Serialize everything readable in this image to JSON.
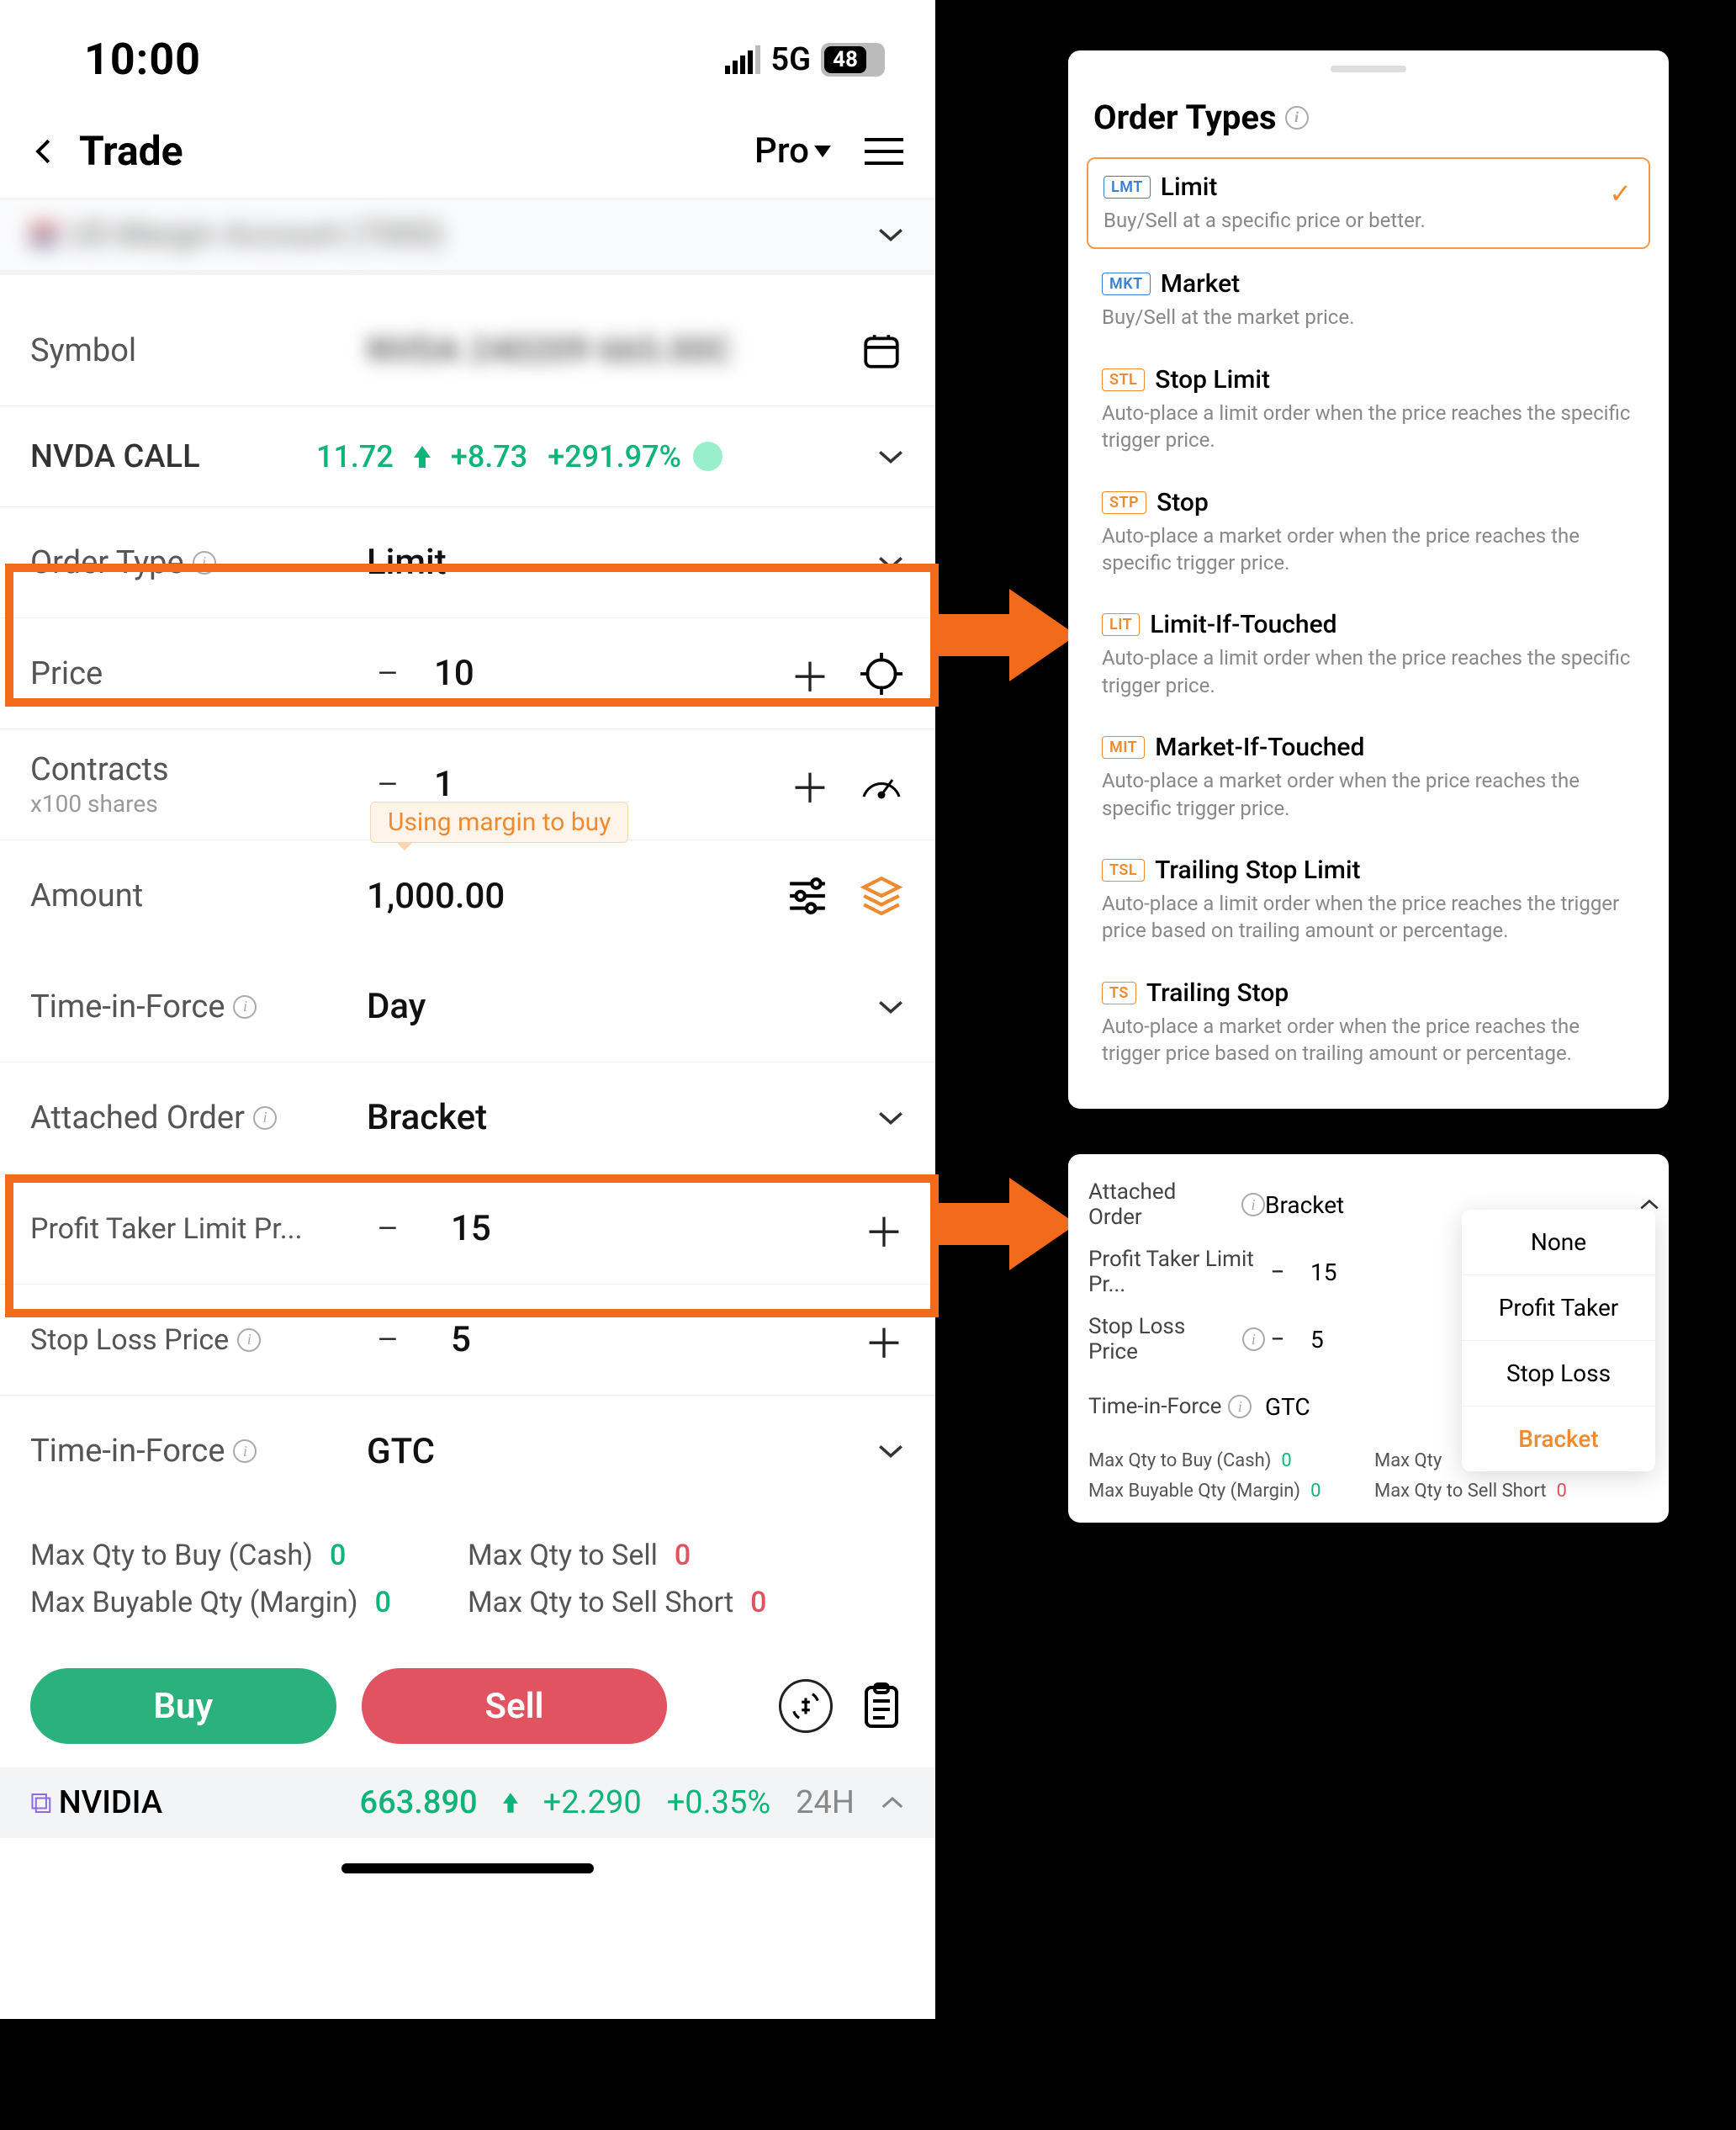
{
  "statusbar": {
    "time": "10:00",
    "signal": "5G",
    "battery": "48"
  },
  "nav": {
    "title": "Trade",
    "mode": "Pro"
  },
  "account_blur": "US Margin Account (7000)   ",
  "symbol": {
    "label": "Symbol",
    "value": "NVDA 240209 665.00C"
  },
  "quote": {
    "name": "NVDA CALL",
    "price": "11.72",
    "change": "+8.73",
    "pct": "+291.97%"
  },
  "order_type": {
    "label": "Order Type",
    "value": "Limit"
  },
  "price": {
    "label": "Price",
    "value": "10"
  },
  "contracts": {
    "label": "Contracts",
    "sub": "x100 shares",
    "value": "1"
  },
  "margin_badge": "Using margin to buy",
  "amount": {
    "label": "Amount",
    "value": "1,000.00"
  },
  "tif": {
    "label": "Time-in-Force",
    "value": "Day"
  },
  "attached": {
    "label": "Attached Order",
    "value": "Bracket"
  },
  "profit_taker": {
    "label": "Profit Taker Limit Pr...",
    "value": "15"
  },
  "stop_loss": {
    "label": "Stop Loss Price",
    "value": "5"
  },
  "tif2": {
    "label": "Time-in-Force",
    "value": "GTC"
  },
  "summary": {
    "buy_cash": {
      "label": "Max Qty to Buy (Cash)",
      "value": "0"
    },
    "buy_margin": {
      "label": "Max Buyable Qty (Margin)",
      "value": "0"
    },
    "sell": {
      "label": "Max Qty to Sell",
      "value": "0"
    },
    "sell_short": {
      "label": "Max Qty to Sell Short",
      "value": "0"
    }
  },
  "actions": {
    "buy": "Buy",
    "sell": "Sell"
  },
  "ticker": {
    "name": "NVIDIA",
    "price": "663.890",
    "change": "+2.290",
    "pct": "+0.35%",
    "tf": "24H"
  },
  "order_types_panel": {
    "title": "Order Types",
    "items": [
      {
        "tag": "LMT",
        "tagcolor": "blue",
        "name": "Limit",
        "desc": "Buy/Sell at a specific price or better.",
        "selected": true
      },
      {
        "tag": "MKT",
        "tagcolor": "blue",
        "name": "Market",
        "desc": "Buy/Sell at the market price."
      },
      {
        "tag": "STL",
        "tagcolor": "orange",
        "name": "Stop Limit",
        "desc": "Auto-place a limit order when the price reaches the specific trigger price."
      },
      {
        "tag": "STP",
        "tagcolor": "orange",
        "name": "Stop",
        "desc": "Auto-place a market order when the price reaches the specific trigger price."
      },
      {
        "tag": "LIT",
        "tagcolor": "orange",
        "name": "Limit-If-Touched",
        "desc": "Auto-place a limit order when the price reaches the specific trigger price."
      },
      {
        "tag": "MIT",
        "tagcolor": "orange",
        "name": "Market-If-Touched",
        "desc": "Auto-place a market order when the price reaches the specific trigger price."
      },
      {
        "tag": "TSL",
        "tagcolor": "orange",
        "name": "Trailing Stop Limit",
        "desc": "Auto-place a limit order when the price reaches the trigger price based on trailing amount or percentage."
      },
      {
        "tag": "TS",
        "tagcolor": "orange",
        "name": "Trailing Stop",
        "desc": "Auto-place a market order when the price reaches the trigger price based on trailing amount or percentage."
      }
    ]
  },
  "attached_panel": {
    "attached": {
      "label": "Attached Order",
      "value": "Bracket"
    },
    "profit": {
      "label": "Profit Taker Limit Pr...",
      "value": "15"
    },
    "stop": {
      "label": "Stop Loss Price",
      "value": "5"
    },
    "tif": {
      "label": "Time-in-Force",
      "value": "GTC"
    },
    "summary": {
      "buy_cash": {
        "label": "Max Qty to Buy (Cash)",
        "value": "0"
      },
      "buy_margin": {
        "label": "Max Buyable Qty (Margin)",
        "value": "0"
      },
      "sell": {
        "label": "Max Qty",
        "value": ""
      },
      "sell_short": {
        "label": "Max Qty to Sell Short",
        "value": "0"
      }
    },
    "dropdown": [
      "None",
      "Profit Taker",
      "Stop Loss",
      "Bracket"
    ],
    "dropdown_active": "Bracket"
  }
}
